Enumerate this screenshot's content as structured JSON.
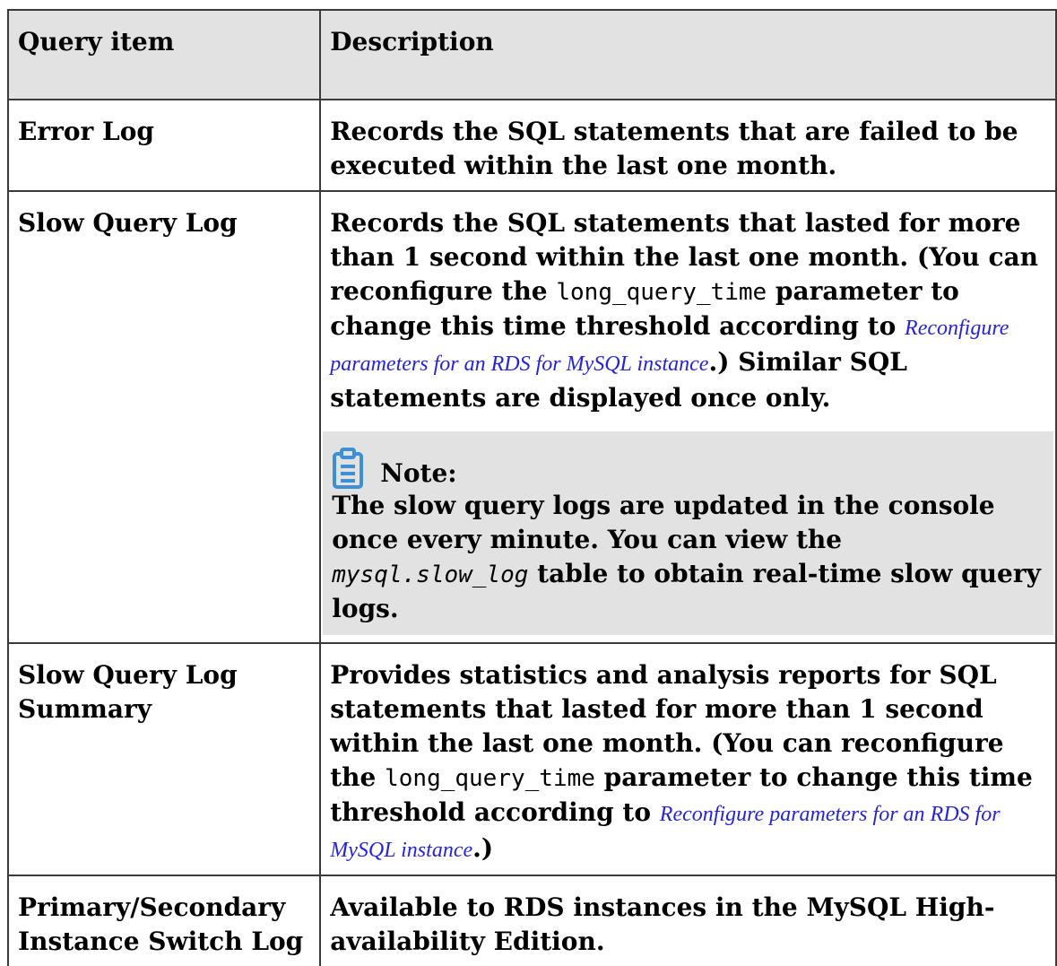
{
  "table": {
    "headers": [
      "Query item",
      "Description"
    ],
    "rows": [
      {
        "item": "Error Log",
        "description": "Records the SQL statements that are failed to be executed within the last one month."
      },
      {
        "item": "Slow Query Log",
        "desc_part1": "Records the SQL statements that lasted for more than 1 second within the last one month. (You can reconfigure the ",
        "code": "long_query_time",
        "desc_part2": " parameter to change this time threshold according to ",
        "link": "Reconfigure parameters for an RDS for MySQL instance",
        "desc_part3": ".) Similar SQL statements are displayed once only.",
        "note": {
          "icon": "clipboard-note-icon",
          "title": "Note:",
          "text_part1": "The slow query logs are updated in the console once every minute. You can view the ",
          "code": "mysql.slow_log",
          "text_part2": " table to obtain real-time slow query logs."
        }
      },
      {
        "item": "Slow Query Log Summary",
        "desc_part1": "Provides statistics and analysis reports for SQL statements that lasted for more than 1 second within the last one month. (You can reconfigure the ",
        "code": "long_query_time",
        "desc_part2": " parameter to change this time threshold according to ",
        "link": "Reconfigure parameters for an RDS for MySQL instance",
        "desc_part3": ".)"
      },
      {
        "item": "Primary/Secondary Instance Switch Log",
        "description": "Available to RDS instances in the MySQL High-availability Edition."
      }
    ]
  },
  "colors": {
    "header_bg": "#e2e2e2",
    "note_bg": "#e2e2e2",
    "link": "#2424e0",
    "icon": "#3d8fd6",
    "border": "#3a3a3a"
  }
}
